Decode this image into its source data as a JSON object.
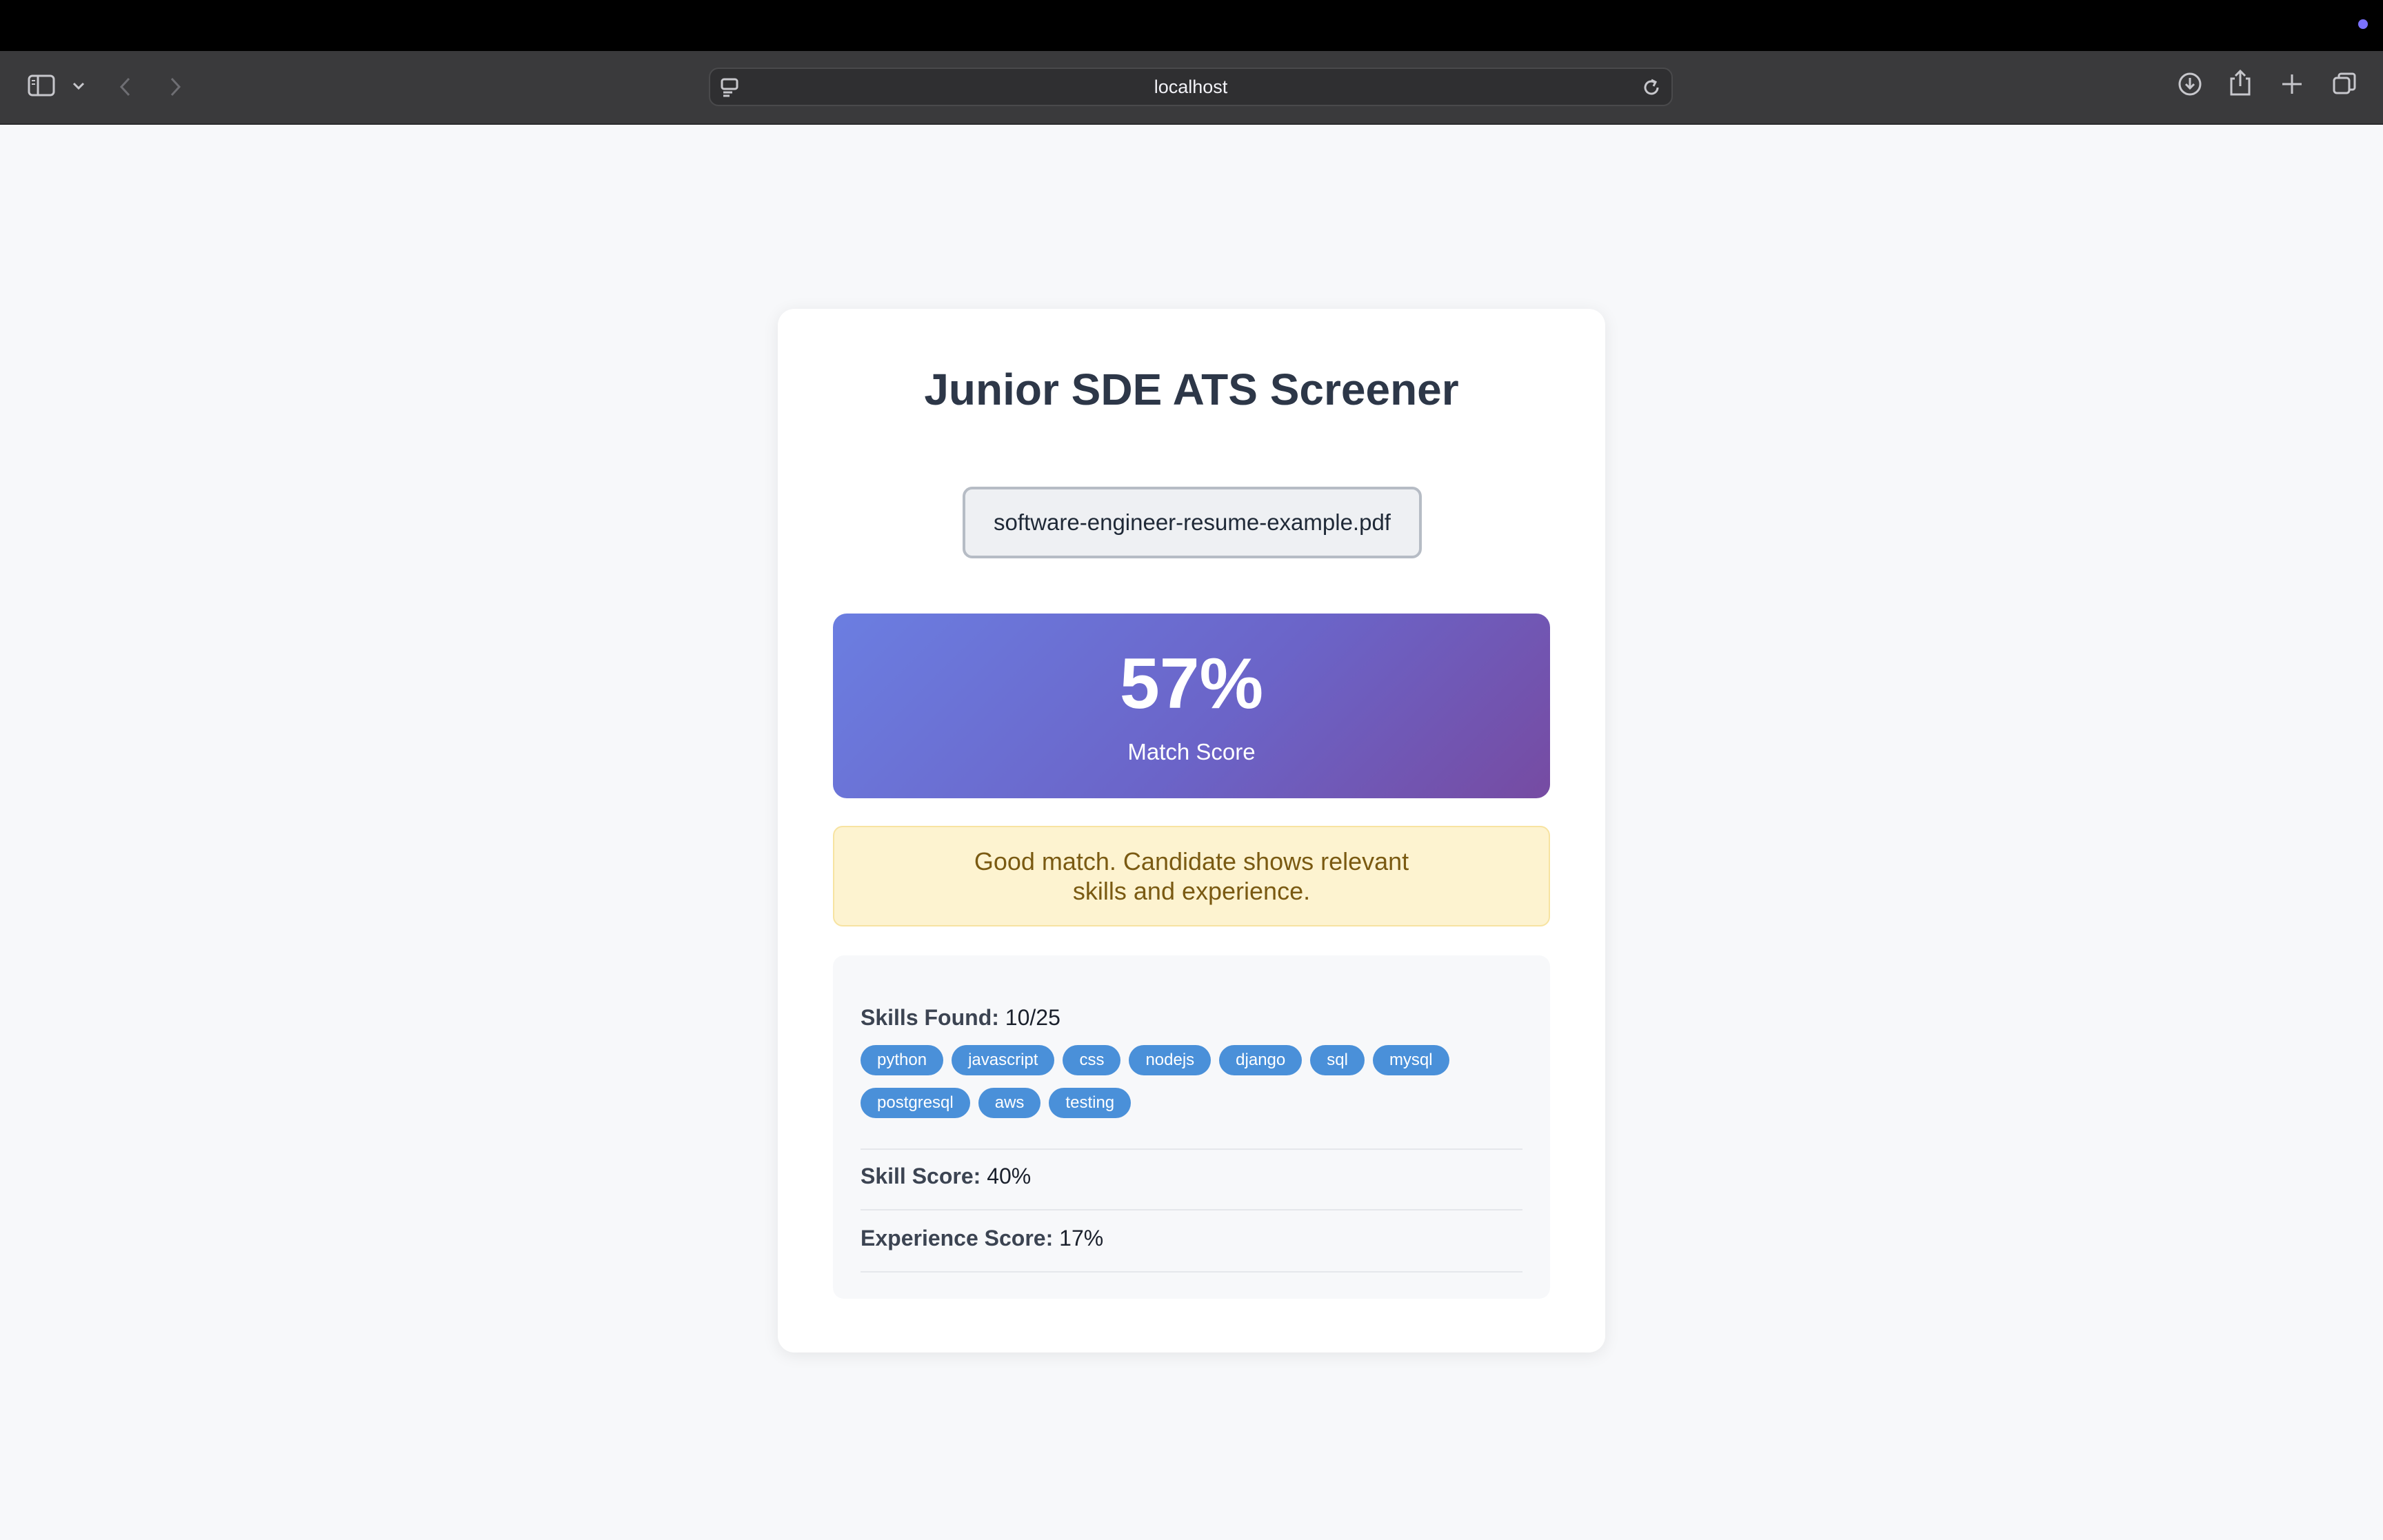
{
  "browser": {
    "url": "localhost"
  },
  "page": {
    "title": "Junior SDE ATS Screener",
    "file_name": "software-engineer-resume-example.pdf",
    "score": {
      "value": "57%",
      "label": "Match Score",
      "fraction": 0.57
    },
    "verdict": "Good match. Candidate shows relevant skills and experience.",
    "skills": {
      "label": "Skills Found:",
      "count": "10/25",
      "tags": [
        "python",
        "javascript",
        "css",
        "nodejs",
        "django",
        "sql",
        "mysql",
        "postgresql",
        "aws",
        "testing"
      ]
    },
    "skill_score": {
      "label": "Skill Score:",
      "value": "40%"
    },
    "experience_score": {
      "label": "Experience Score:",
      "value": "17%"
    }
  },
  "colors": {
    "accent_gradient_start": "#6b7ee1",
    "accent_gradient_end": "#764ba2",
    "tag_blue": "#4a90d9",
    "verdict_bg": "#fdf3d0"
  },
  "icons": [
    "sidebar-icon",
    "chevron-down-icon",
    "back-arrow-icon",
    "forward-arrow-icon",
    "site-settings-icon",
    "reload-icon",
    "download-icon",
    "share-icon",
    "new-tab-icon",
    "tab-overview-icon"
  ]
}
